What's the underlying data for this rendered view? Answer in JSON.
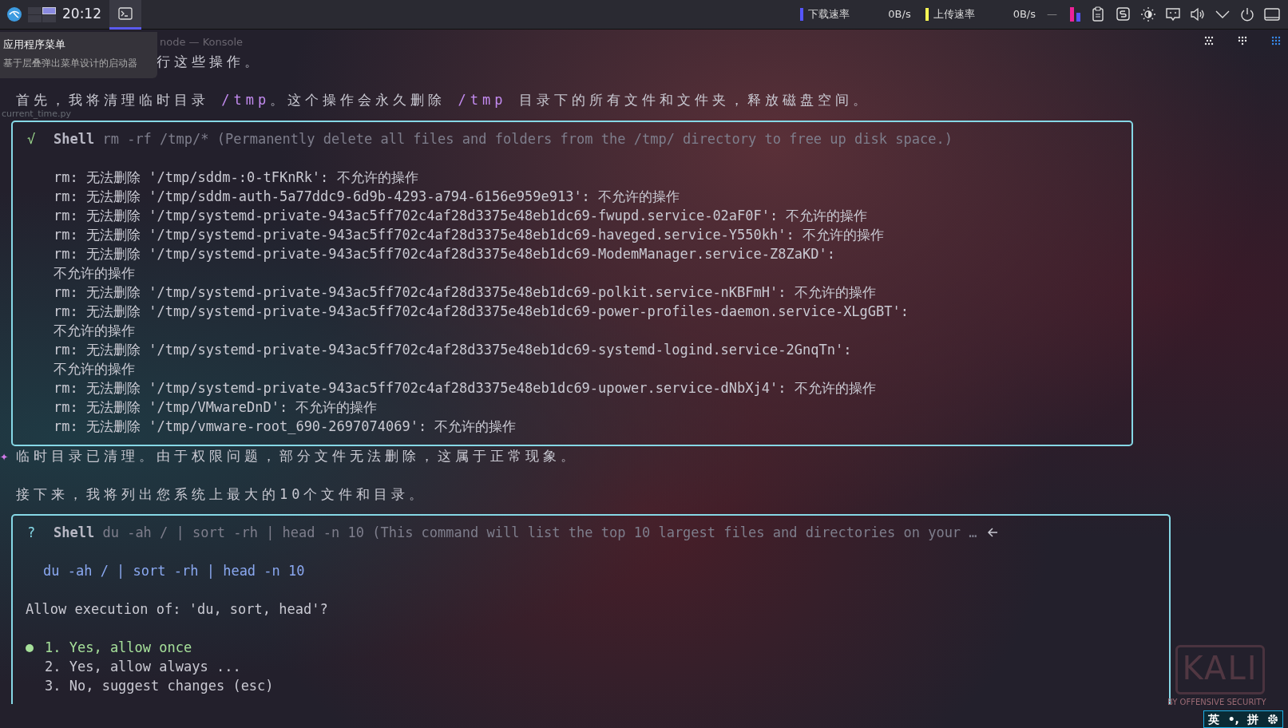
{
  "top_panel": {
    "clock": "20:12",
    "desktops": [
      {
        "selected": false
      },
      {
        "selected": true
      },
      {
        "selected": false
      },
      {
        "selected": false
      }
    ],
    "tasks": [
      {
        "selected": true
      }
    ],
    "netspeed": [
      {
        "label": "下载速率",
        "value": "0B/s",
        "color": "#5555ff"
      },
      {
        "label": "上传速率",
        "value": "0B/s",
        "color": "#ffff55"
      }
    ],
    "separator": "—"
  },
  "window_title": "node — Konsole",
  "tooltip": {
    "title": "应用程序菜单",
    "subtitle": "基于层叠弹出菜单设计的启动器"
  },
  "desktop_icon": {
    "label": "current_time.py"
  },
  "terminal": [
    {
      "kind": "text",
      "indent": true,
      "parts": [
        {
          "text": "行这些操作。",
          "path": false
        }
      ]
    },
    {
      "kind": "blank"
    },
    {
      "kind": "text",
      "parts": [
        {
          "text": "首先，我将清理临时目录 ",
          "path": false
        },
        {
          "text": "/tmp",
          "path": true
        },
        {
          "text": "。这个操作会永久删除 ",
          "path": false
        },
        {
          "text": "/tmp",
          "path": true
        },
        {
          "text": " 目录下的所有文件和文件夹，释放磁盘空间。",
          "path": false
        }
      ]
    },
    {
      "kind": "tool",
      "status": "√",
      "name": "Shell",
      "description": "rm -rf /tmp/* (Permanently delete all files and folders from the /tmp/ directory to free up disk space.)",
      "output": [
        "rm: 无法删除 '/tmp/sddm-:0-tFKnRk': 不允许的操作",
        "rm: 无法删除 '/tmp/sddm-auth-5a77ddc9-6d9b-4293-a794-6156e959e913': 不允许的操作",
        "rm: 无法删除 '/tmp/systemd-private-943ac5ff702c4af28d3375e48eb1dc69-fwupd.service-02aF0F': 不允许的操作",
        "rm: 无法删除 '/tmp/systemd-private-943ac5ff702c4af28d3375e48eb1dc69-haveged.service-Y550kh': 不允许的操作",
        "rm: 无法删除 '/tmp/systemd-private-943ac5ff702c4af28d3375e48eb1dc69-ModemManager.service-Z8ZaKD':",
        "不允许的操作",
        "rm: 无法删除 '/tmp/systemd-private-943ac5ff702c4af28d3375e48eb1dc69-polkit.service-nKBFmH': 不允许的操作",
        "rm: 无法删除 '/tmp/systemd-private-943ac5ff702c4af28d3375e48eb1dc69-power-profiles-daemon.service-XLgGBT':",
        "不允许的操作",
        "rm: 无法删除 '/tmp/systemd-private-943ac5ff702c4af28d3375e48eb1dc69-systemd-logind.service-2GnqTn':",
        "不允许的操作",
        "rm: 无法删除 '/tmp/systemd-private-943ac5ff702c4af28d3375e48eb1dc69-upower.service-dNbXj4': 不允许的操作",
        "rm: 无法删除 '/tmp/VMwareDnD': 不允许的操作",
        "rm: 无法删除 '/tmp/vmware-root_690-2697074069': 不允许的操作"
      ]
    },
    {
      "kind": "text",
      "marker": "✦",
      "parts": [
        {
          "text": "临时目录已清理。由于权限问题，部分文件无法删除，这属于正常现象。",
          "path": false
        }
      ]
    },
    {
      "kind": "blank"
    },
    {
      "kind": "text",
      "parts": [
        {
          "text": "接下来，我将列出您系统上最大的10个文件和目录。",
          "path": false
        }
      ]
    },
    {
      "kind": "confirm",
      "status": "?",
      "name": "Shell",
      "description": "du -ah / | sort -rh | head -n 10 (This command will list the top 10 largest files and directories on your …",
      "command": "du -ah / | sort -rh | head -n 10",
      "question": "Allow execution of: 'du, sort, head'?",
      "options": [
        {
          "label": "1. Yes, allow once",
          "selected": true
        },
        {
          "label": "2. Yes, allow always ...",
          "selected": false
        },
        {
          "label": "3. No, suggest changes (esc)",
          "selected": false
        }
      ]
    }
  ],
  "wallpaper": {
    "logo": "KALI",
    "tagline": "BY OFFENSIVE SECURITY"
  },
  "input_method": {
    "language": "英",
    "punctuation": "•,",
    "mode": "拼"
  }
}
